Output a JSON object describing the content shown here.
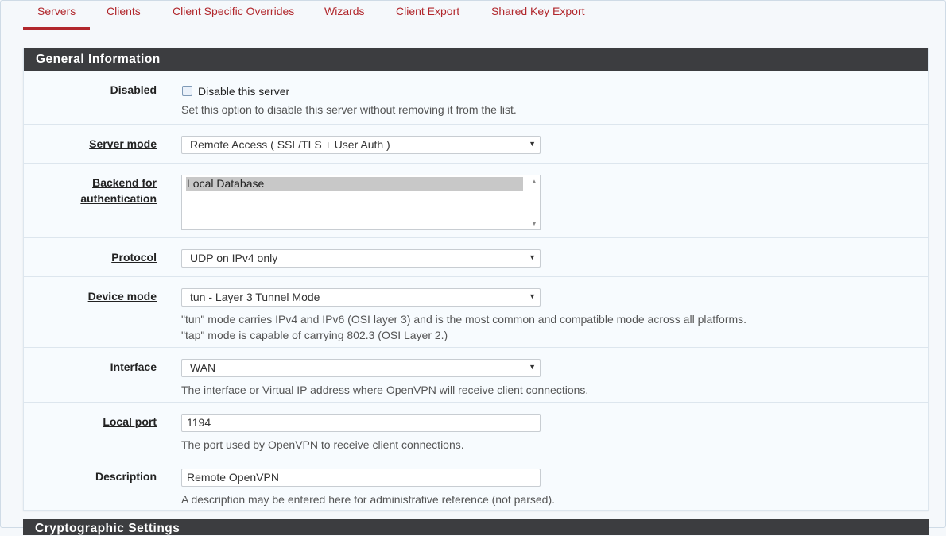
{
  "tabs": [
    "Servers",
    "Clients",
    "Client Specific Overrides",
    "Wizards",
    "Client Export",
    "Shared Key Export"
  ],
  "active_tab": "Servers",
  "panel_title": "General Information",
  "fields": {
    "disabled": {
      "label": "Disabled",
      "checkbox_label": "Disable this server",
      "checked": false,
      "help": "Set this option to disable this server without removing it from the list."
    },
    "server_mode": {
      "label": "Server mode",
      "value": "Remote Access ( SSL/TLS + User Auth )"
    },
    "backend": {
      "label_line1": "Backend for",
      "label_line2": "authentication",
      "options": [
        "Local Database"
      ],
      "selected": "Local Database"
    },
    "protocol": {
      "label": "Protocol",
      "value": "UDP on IPv4 only"
    },
    "device_mode": {
      "label": "Device mode",
      "value": "tun - Layer 3 Tunnel Mode",
      "help_line1": "\"tun\" mode carries IPv4 and IPv6 (OSI layer 3) and is the most common and compatible mode across all platforms.",
      "help_line2": "\"tap\" mode is capable of carrying 802.3 (OSI Layer 2.)"
    },
    "interface": {
      "label": "Interface",
      "value": "WAN",
      "help": "The interface or Virtual IP address where OpenVPN will receive client connections."
    },
    "local_port": {
      "label": "Local port",
      "value": "1194",
      "help": "The port used by OpenVPN to receive client connections."
    },
    "description": {
      "label": "Description",
      "value": "Remote OpenVPN",
      "help": "A description may be entered here for administrative reference (not parsed)."
    }
  },
  "next_panel_title": "Cryptographic Settings",
  "colors": {
    "accent": "#b1272c",
    "header_bg": "#3c3d40",
    "page_bg": "#f5f8fb"
  }
}
